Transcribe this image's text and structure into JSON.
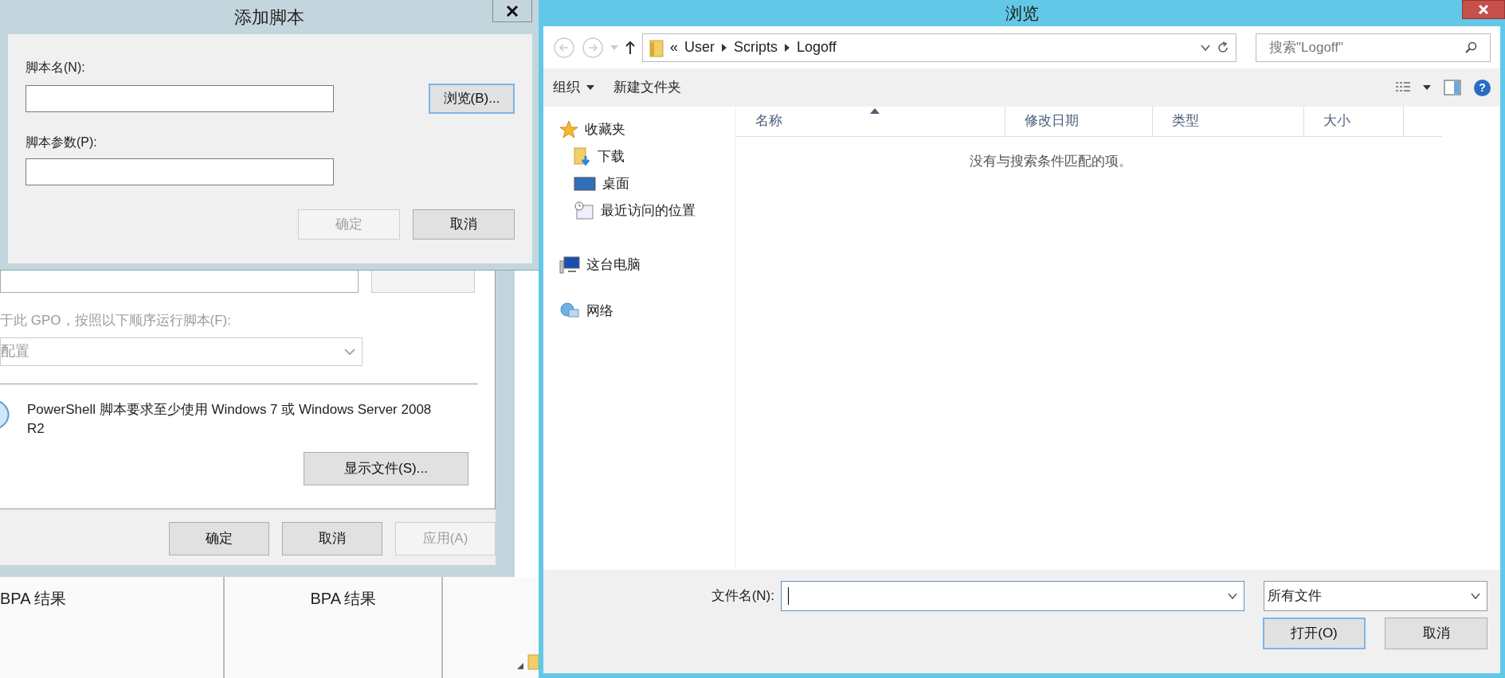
{
  "add_script_dialog": {
    "title": "添加脚本",
    "script_name_label": "脚本名(N):",
    "browse_button": {
      "label": "浏览(B)...",
      "default": true
    },
    "params_label": "脚本参数(P):",
    "buttons": [
      {
        "label": "确定",
        "disabled": true,
        "default": false
      },
      {
        "label": "取消",
        "disabled": false,
        "default": false
      }
    ]
  },
  "properties_dialog": {
    "order_label": "于此 GPO，按照以下顺序运行脚本(F):",
    "order_select": "配置",
    "order_disabled": true,
    "note": "PowerShell 脚本要求至少使用 Windows 7 或 Windows Server 2008 R2",
    "show_files_button": "显示文件(S)...",
    "buttons": [
      {
        "label": "确定",
        "disabled": false
      },
      {
        "label": "取消",
        "disabled": false
      },
      {
        "label": "应用(A)",
        "disabled": true
      }
    ]
  },
  "background_panels": [
    {
      "label": "BPA 结果"
    },
    {
      "label": "BPA 结果"
    }
  ],
  "browse_dialog": {
    "title": "浏览",
    "overflow_marker": "«",
    "breadcrumb": [
      "User",
      "Scripts",
      "Logoff"
    ],
    "search": {
      "placeholder": "搜索\"Logoff\""
    },
    "toolbar": [
      {
        "label": "组织",
        "dropdown": true
      },
      {
        "label": "新建文件夹",
        "dropdown": false
      }
    ],
    "nav": [
      {
        "label": "收藏夹",
        "kind": "star",
        "children": [
          {
            "label": "下载",
            "kind": "download"
          },
          {
            "label": "桌面",
            "kind": "desktop"
          },
          {
            "label": "最近访问的位置",
            "kind": "recent"
          }
        ]
      },
      {
        "label": "这台电脑",
        "kind": "computer"
      },
      {
        "label": "网络",
        "kind": "network"
      }
    ],
    "columns": [
      {
        "label": "名称",
        "sorted": true
      },
      {
        "label": "修改日期",
        "sorted": false
      },
      {
        "label": "类型",
        "sorted": false
      },
      {
        "label": "大小",
        "sorted": false
      }
    ],
    "help_label": "?",
    "empty_message": "没有与搜索条件匹配的项。",
    "filename_label": "文件名(N):",
    "filetype": "所有文件",
    "buttons": [
      {
        "label": "打开(O)",
        "default": true
      },
      {
        "label": "取消",
        "default": false
      }
    ]
  }
}
